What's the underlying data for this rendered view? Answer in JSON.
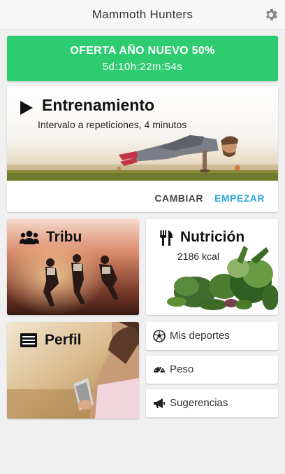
{
  "app": {
    "title": "Mammoth Hunters"
  },
  "icons": {
    "settings": "gear-icon"
  },
  "colors": {
    "offer_bg": "#2ecc71",
    "accent": "#2aa6e0"
  },
  "offer": {
    "title": "OFERTA AÑO NUEVO 50%",
    "countdown": "5d:10h:22m:54s"
  },
  "training": {
    "title": "Entrenamiento",
    "subtitle": "Intervalo a repeticiones, 4 minutos",
    "change_label": "CAMBIAR",
    "start_label": "EMPEZAR"
  },
  "tribe": {
    "label": "Tribu"
  },
  "nutrition": {
    "label": "Nutrición",
    "kcal": "2186 kcal"
  },
  "profile": {
    "label": "Perfil"
  },
  "menu": [
    {
      "label": "Mis deportes",
      "icon": "soccer-ball-icon"
    },
    {
      "label": "Peso",
      "icon": "gauge-icon"
    },
    {
      "label": "Sugerencias",
      "icon": "megaphone-icon"
    }
  ]
}
